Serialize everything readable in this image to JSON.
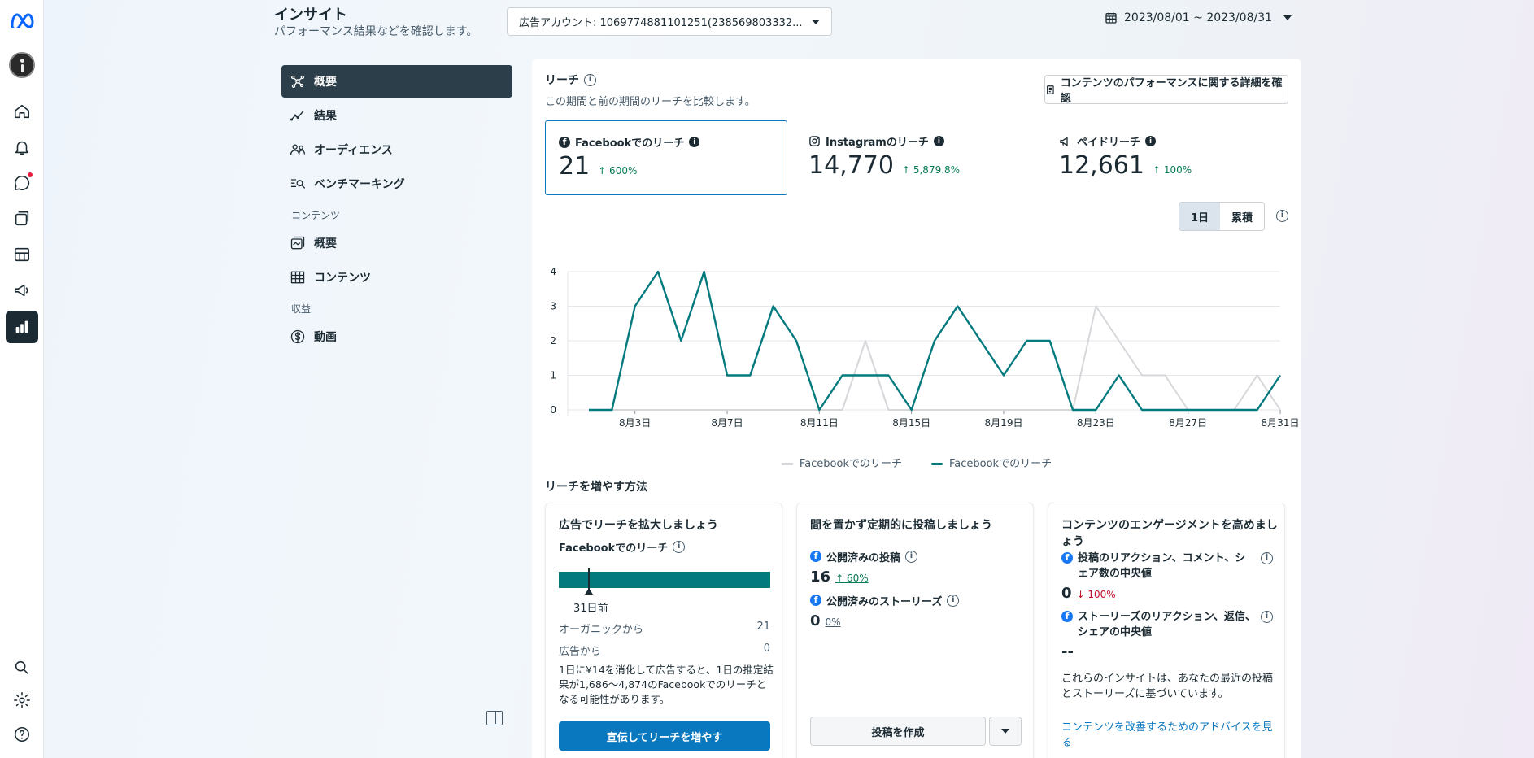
{
  "header": {
    "title": "インサイト",
    "subtitle": "パフォーマンス結果などを確認します。",
    "account": "広告アカウント: 1069774881101251(238569803332...",
    "date_range": "2023/08/01 ~ 2023/08/31"
  },
  "nav": {
    "items": [
      {
        "label": "概要"
      },
      {
        "label": "結果"
      },
      {
        "label": "オーディエンス"
      },
      {
        "label": "ベンチマーキング"
      }
    ],
    "content_section": "コンテンツ",
    "content_items": [
      {
        "label": "概要"
      },
      {
        "label": "コンテンツ"
      }
    ],
    "revenue_section": "収益",
    "revenue_items": [
      {
        "label": "動画"
      }
    ]
  },
  "reach": {
    "title": "リーチ",
    "subtitle": "この期間と前の期間のリーチを比較します。",
    "detail_button": "コンテンツのパフォーマンスに関する詳細を確認",
    "metrics": [
      {
        "label": "Facebookでのリーチ",
        "value": "21",
        "change": "↑ 600%"
      },
      {
        "label": "Instagramのリーチ",
        "value": "14,770",
        "change": "↑ 5,879.8%"
      },
      {
        "label": "ペイドリーチ",
        "value": "12,661",
        "change": "↑ 100%"
      }
    ],
    "toggle": {
      "daily": "1日",
      "cumulative": "累積"
    }
  },
  "chart_data": {
    "type": "line",
    "x": [
      1,
      2,
      3,
      4,
      5,
      6,
      7,
      8,
      9,
      10,
      11,
      12,
      13,
      14,
      15,
      16,
      17,
      18,
      19,
      20,
      21,
      22,
      23,
      24,
      25,
      26,
      27,
      28,
      29,
      30,
      31
    ],
    "categories_ticks": [
      "8月3日",
      "8月7日",
      "8月11日",
      "8月15日",
      "8月19日",
      "8月23日",
      "8月27日",
      "8月31日"
    ],
    "tick_days": [
      3,
      7,
      11,
      15,
      19,
      23,
      27,
      31
    ],
    "ylim": [
      0,
      4
    ],
    "yticks": [
      "0",
      "1",
      "2",
      "3",
      "4"
    ],
    "series": [
      {
        "name": "Facebookでのリーチ",
        "color": "#d5d7da",
        "values": [
          0,
          0,
          0,
          0,
          0,
          0,
          0,
          0,
          0,
          0,
          0,
          0,
          2,
          0,
          0,
          0,
          0,
          0,
          0,
          0,
          0,
          0,
          3,
          2,
          1,
          1,
          0,
          0,
          0,
          1,
          0
        ]
      },
      {
        "name": "Facebookでのリーチ",
        "color": "#037a7e",
        "values": [
          0,
          0,
          3,
          4,
          2,
          4,
          1,
          1,
          3,
          2,
          0,
          1,
          1,
          1,
          0,
          2,
          3,
          2,
          1,
          2,
          2,
          0,
          0,
          1,
          0,
          0,
          0,
          0,
          0,
          0,
          1
        ]
      }
    ]
  },
  "grow": {
    "title": "リーチを増やす方法",
    "ads_card": {
      "title": "広告でリーチを拡大しましょう",
      "sub": "Facebookでのリーチ",
      "marker_label": "31日前",
      "organic_label": "オーガニックから",
      "organic_value": "21",
      "ads_label": "広告から",
      "ads_value": "0",
      "note": "1日に¥14を消化して広告すると、1日の推定結果が1,686～4,874のFacebookでのリーチとなる可能性があります。",
      "button": "宣伝してリーチを増やす"
    },
    "post_card": {
      "title": "間を置かず定期的に投稿しましょう",
      "posts_label": "公開済みの投稿",
      "posts_value": "16",
      "posts_change": "↑ 60%",
      "stories_label": "公開済みのストーリーズ",
      "stories_value": "0",
      "stories_change": "0%",
      "button": "投稿を作成"
    },
    "engage_card": {
      "title": "コンテンツのエンゲージメントを高めましょう",
      "post_median_label": "投稿のリアクション、コメント、シェア数の中央値",
      "post_median_value": "0",
      "post_median_change": "↓ 100%",
      "story_median_label": "ストーリーズのリアクション、返信、シェアの中央値",
      "story_median_value": "--",
      "text": "これらのインサイトは、あなたの最近の投稿とストーリーズに基づいています。",
      "link": "コンテンツを改善するためのアドバイスを見る"
    }
  },
  "colors": {
    "accent": "#0a78be",
    "teal": "#037a7e",
    "positive": "#057a55",
    "negative": "#c3102a"
  }
}
